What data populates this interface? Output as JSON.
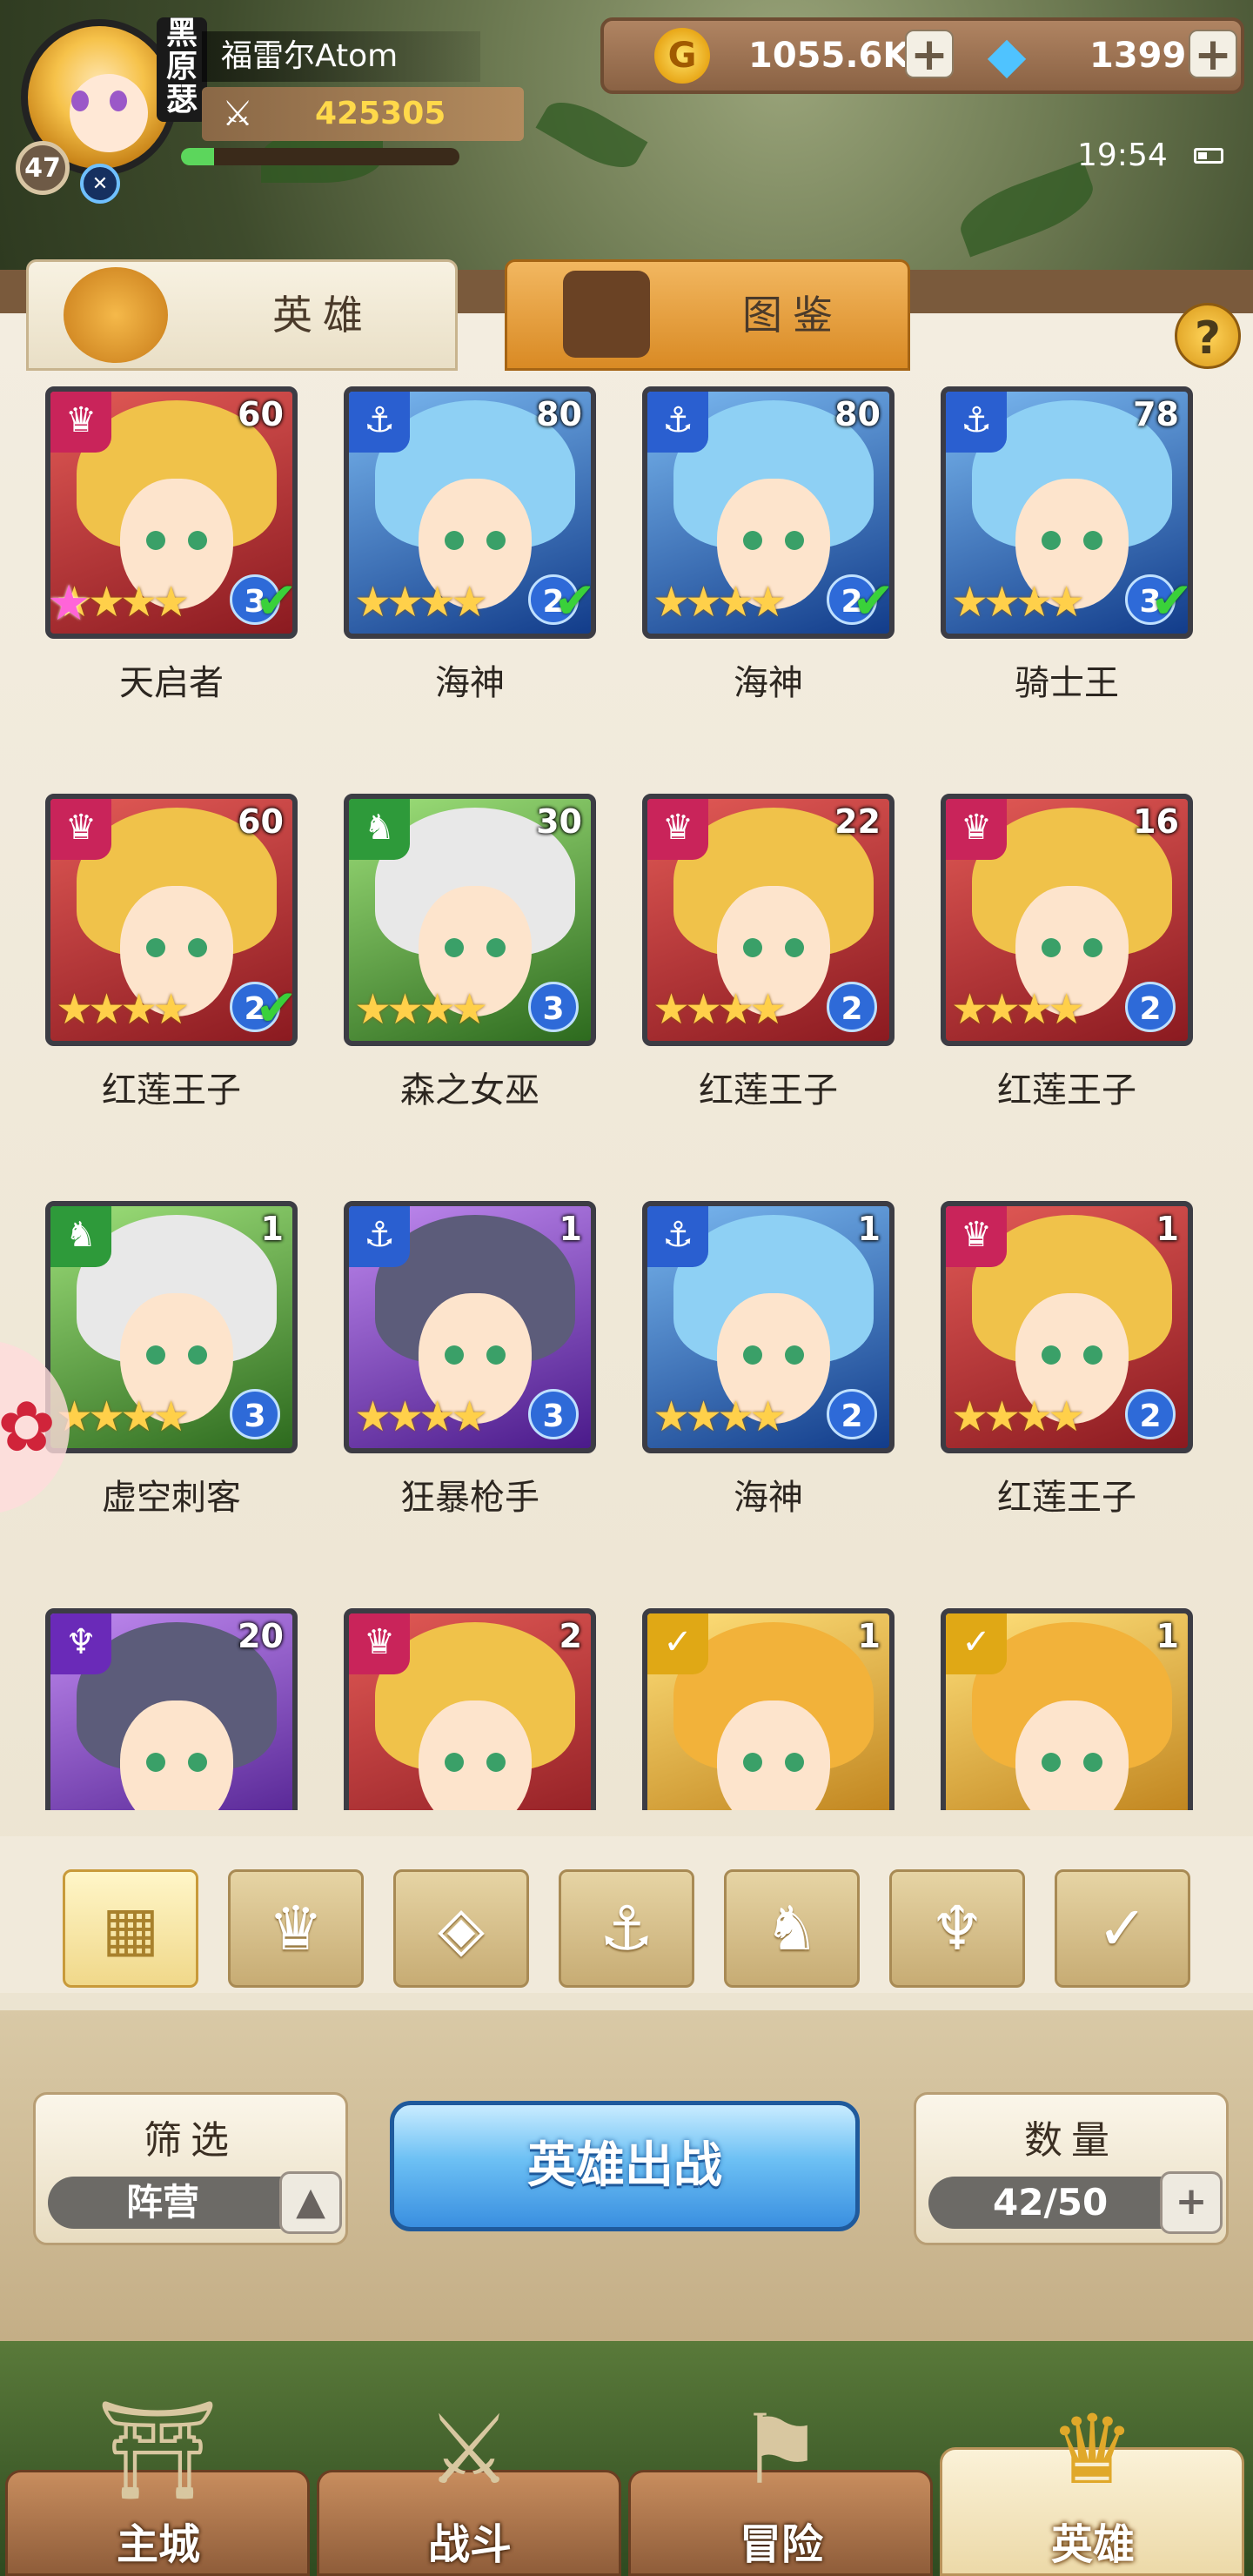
{
  "player": {
    "name": "福雷尔Atom",
    "vip_label": "黑\n原\n瑟",
    "level": "47",
    "power": "425305",
    "exp_fraction": 0.12
  },
  "resources": {
    "gold": "1055.6K",
    "gems": "1399"
  },
  "status_bar": {
    "time": "19:54"
  },
  "tabs": [
    {
      "label": "英雄",
      "active": true
    },
    {
      "label": "图鉴",
      "active": false
    }
  ],
  "help_label": "?",
  "heroes": [
    {
      "name": "天启者",
      "level": "60",
      "faction": "fire",
      "stars": "★★★★",
      "rank": "3",
      "checked": true,
      "special_star": true,
      "color": "red"
    },
    {
      "name": "海神",
      "level": "80",
      "faction": "water",
      "stars": "★★★★",
      "rank": "2",
      "checked": true,
      "special_star": false,
      "color": "blue"
    },
    {
      "name": "海神",
      "level": "80",
      "faction": "water",
      "stars": "★★★★",
      "rank": "2",
      "checked": true,
      "special_star": false,
      "color": "blue"
    },
    {
      "name": "骑士王",
      "level": "78",
      "faction": "water",
      "stars": "★★★★",
      "rank": "3",
      "checked": true,
      "special_star": false,
      "color": "blue"
    },
    {
      "name": "红莲王子",
      "level": "60",
      "faction": "fire",
      "stars": "★★★★",
      "rank": "2",
      "checked": true,
      "special_star": false,
      "color": "red"
    },
    {
      "name": "森之女巫",
      "level": "30",
      "faction": "nature",
      "stars": "★★★★",
      "rank": "3",
      "checked": false,
      "special_star": false,
      "color": "green"
    },
    {
      "name": "红莲王子",
      "level": "22",
      "faction": "fire",
      "stars": "★★★★",
      "rank": "2",
      "checked": false,
      "special_star": false,
      "color": "red"
    },
    {
      "name": "红莲王子",
      "level": "16",
      "faction": "fire",
      "stars": "★★★★",
      "rank": "2",
      "checked": false,
      "special_star": false,
      "color": "red"
    },
    {
      "name": "虚空刺客",
      "level": "1",
      "faction": "nature",
      "stars": "★★★★",
      "rank": "3",
      "checked": false,
      "special_star": false,
      "color": "green"
    },
    {
      "name": "狂暴枪手",
      "level": "1",
      "faction": "water",
      "stars": "★★★★",
      "rank": "3",
      "checked": false,
      "special_star": false,
      "color": "purple"
    },
    {
      "name": "海神",
      "level": "1",
      "faction": "water",
      "stars": "★★★★",
      "rank": "2",
      "checked": false,
      "special_star": false,
      "color": "blue"
    },
    {
      "name": "红莲王子",
      "level": "1",
      "faction": "fire",
      "stars": "★★★★",
      "rank": "2",
      "checked": false,
      "special_star": false,
      "color": "red"
    },
    {
      "name": "",
      "level": "20",
      "faction": "dark",
      "stars": "",
      "rank": "",
      "checked": false,
      "special_star": false,
      "color": "purple"
    },
    {
      "name": "",
      "level": "2",
      "faction": "fire",
      "stars": "",
      "rank": "",
      "checked": false,
      "special_star": false,
      "color": "red"
    },
    {
      "name": "",
      "level": "1",
      "faction": "light",
      "stars": "",
      "rank": "",
      "checked": false,
      "special_star": false,
      "color": "gold"
    },
    {
      "name": "",
      "level": "1",
      "faction": "light",
      "stars": "",
      "rank": "",
      "checked": false,
      "special_star": false,
      "color": "gold"
    }
  ],
  "faction_filters": [
    {
      "icon": "all-grid-icon",
      "glyph": "▦",
      "active": true
    },
    {
      "icon": "fire-faction-icon",
      "glyph": "♛",
      "active": false
    },
    {
      "icon": "earth-faction-icon",
      "glyph": "◈",
      "active": false
    },
    {
      "icon": "water-faction-icon",
      "glyph": "⚓",
      "active": false
    },
    {
      "icon": "nature-faction-icon",
      "glyph": "♞",
      "active": false
    },
    {
      "icon": "dark-faction-icon",
      "glyph": "♆",
      "active": false
    },
    {
      "icon": "light-faction-icon",
      "glyph": "✓",
      "active": false
    }
  ],
  "filter_box": {
    "title": "筛选",
    "value": "阵营"
  },
  "deploy_button": "英雄出战",
  "count_box": {
    "title": "数量",
    "value": "42/50"
  },
  "nav": [
    {
      "label": "主城",
      "icon": "castle-icon",
      "glyph": "⛩",
      "active": false
    },
    {
      "label": "战斗",
      "icon": "crossed-swords-icon",
      "glyph": "⚔",
      "active": false
    },
    {
      "label": "冒险",
      "icon": "adventure-map-icon",
      "glyph": "⚑",
      "active": false
    },
    {
      "label": "英雄",
      "icon": "hero-crest-icon",
      "glyph": "♛",
      "active": true
    }
  ]
}
